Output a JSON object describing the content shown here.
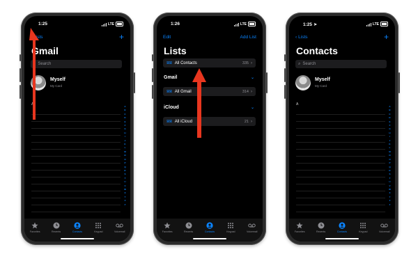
{
  "phones": [
    {
      "time": "1:25",
      "carrier": "LTE",
      "nav_left": "Lists",
      "nav_right": "+",
      "title": "Gmail",
      "search_placeholder": "Search",
      "card_name": "Myself",
      "card_sub": "My Card",
      "section": "A"
    },
    {
      "time": "1:26",
      "carrier": "LTE",
      "nav_left": "Edit",
      "nav_right": "Add List",
      "title": "Lists",
      "rows": [
        {
          "name": "All Contacts",
          "count": "335"
        },
        {
          "group": "Gmail"
        },
        {
          "name": "All Gmail",
          "count": "314"
        },
        {
          "group": "iCloud"
        },
        {
          "name": "All iCloud",
          "count": "21"
        }
      ]
    },
    {
      "time": "1:25",
      "carrier": "LTE",
      "nav_left": "Lists",
      "nav_right": "+",
      "title": "Contacts",
      "search_placeholder": "Search",
      "card_name": "Myself",
      "card_sub": "My Card",
      "section": "A"
    }
  ],
  "alphabet": [
    "A",
    "B",
    "C",
    "D",
    "E",
    "F",
    "G",
    "H",
    "I",
    "J",
    "K",
    "L",
    "M",
    "N",
    "O",
    "P",
    "Q",
    "R",
    "S",
    "T",
    "U",
    "V",
    "W",
    "X",
    "Y",
    "Z",
    "#"
  ],
  "tabs": [
    {
      "label": "Favorites",
      "icon": "star-icon"
    },
    {
      "label": "Recents",
      "icon": "clock-icon"
    },
    {
      "label": "Contacts",
      "icon": "person-icon"
    },
    {
      "label": "Keypad",
      "icon": "keypad-icon"
    },
    {
      "label": "Voicemail",
      "icon": "voicemail-icon"
    }
  ],
  "colors": {
    "accent": "#0a84ff",
    "arrow": "#e8361f",
    "background": "#000000"
  }
}
